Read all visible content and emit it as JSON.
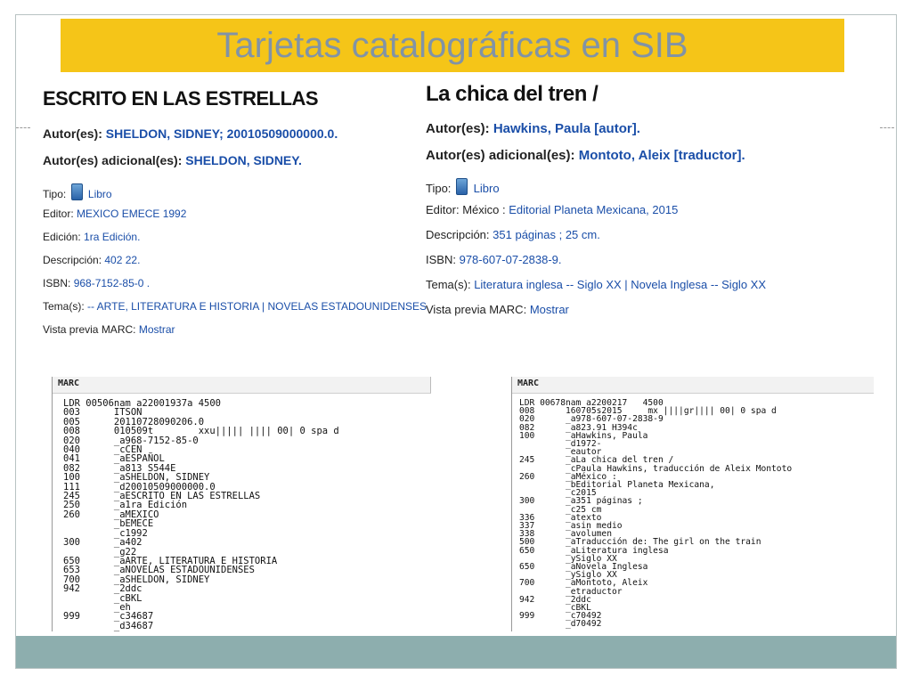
{
  "title": "Tarjetas catalográficas en SIB",
  "left_record": {
    "title": "ESCRITO EN LAS ESTRELLAS",
    "autor_label": "Autor(es):",
    "autor_value": "SHELDON, SIDNEY; 20010509000000.0.",
    "autor_adicional_label": "Autor(es) adicional(es):",
    "autor_adicional_value": "SHELDON, SIDNEY.",
    "tipo_label": "Tipo:",
    "tipo_value": "Libro",
    "editor_label": "Editor:",
    "editor_value": "MEXICO EMECE 1992",
    "edicion_label": "Edición:",
    "edicion_value": "1ra Edición.",
    "descripcion_label": "Descripción:",
    "descripcion_value": "402 22.",
    "isbn_label": "ISBN:",
    "isbn_value": "968-7152-85-0 .",
    "temas_label": "Tema(s):",
    "temas_value": "-- ARTE, LITERATURA E HISTORIA | NOVELAS ESTADOUNIDENSES",
    "vista_label": "Vista previa MARC:",
    "vista_link": "Mostrar"
  },
  "right_record": {
    "title": "La chica del tren /",
    "autor_label": "Autor(es):",
    "autor_value": "Hawkins, Paula [autor].",
    "autor_adicional_label": "Autor(es) adicional(es):",
    "autor_adicional_value": "Montoto, Aleix [traductor].",
    "tipo_label": "Tipo:",
    "tipo_value": "Libro",
    "editor_label": "Editor:",
    "editor_prefix": "México :",
    "editor_value": "Editorial Planeta Mexicana, 2015",
    "descripcion_label": "Descripción:",
    "descripcion_value": "351 páginas ; 25 cm.",
    "isbn_label": "ISBN:",
    "isbn_value": "978-607-07-2838-9.",
    "temas_label": "Tema(s):",
    "temas_value": "Literatura inglesa -- Siglo XX | Novela Inglesa -- Siglo XX",
    "vista_label": "Vista previa MARC:",
    "vista_link": "Mostrar"
  },
  "marc_left": {
    "header": "MARC",
    "lines": [
      "LDR 00506nam a22001937a 4500",
      "003      ITSON",
      "005      20110728090206.0",
      "008      010509t        xxu||||| |||| 00| 0 spa d",
      "020      _a968-7152-85-0",
      "040      _cCEN",
      "041      _aESPAÑOL",
      "082      _a813 S544E",
      "100      _aSHELDON, SIDNEY",
      "111      _d20010509000000.0",
      "245      _aESCRITO EN LAS ESTRELLAS",
      "250      _a1ra Edición",
      "260      _aMEXICO",
      "         _bEMECE",
      "         _c1992",
      "300      _a402",
      "         _g22",
      "650      _aARTE, LITERATURA E HISTORIA",
      "653      _aNOVELAS ESTADOUNIDENSES",
      "700      _aSHELDON, SIDNEY",
      "942      _2ddc",
      "         _cBKL",
      "         _eh",
      "999      _c34687",
      "         _d34687"
    ]
  },
  "marc_right": {
    "header": "MARC",
    "lines": [
      "LDR 00678nam a2200217   4500",
      "008      160705s2015     mx ||||gr|||| 00| 0 spa d",
      "020      _a978-607-07-2838-9",
      "082      _a823.91 H394c",
      "100      _aHawkins, Paula",
      "         _d1972-",
      "         _eautor",
      "245      _aLa chica del tren /",
      "         _cPaula Hawkins, traducción de Aleix Montoto",
      "260      _aMéxico :",
      "         _bEditorial Planeta Mexicana,",
      "         _c2015",
      "300      _a351 páginas ;",
      "         _c25 cm",
      "336      _atexto",
      "337      _asin medio",
      "338      _avolumen",
      "500      _aTraducción de: The girl on the train",
      "650      _aLiteratura inglesa",
      "         _ySiglo XX",
      "650      _aNovela Inglesa",
      "         _ySiglo XX",
      "700      _aMontoto, Aleix",
      "         _etraductor",
      "942      _2ddc",
      "         _cBKL",
      "999      _c70492",
      "         _d70492"
    ]
  },
  "colors": {
    "title_bar": "#f5c518",
    "title_text": "#8193a6",
    "link": "#1a4ea8",
    "footer_band": "#8daeae"
  },
  "icons": {
    "tipo": "book-icon"
  }
}
